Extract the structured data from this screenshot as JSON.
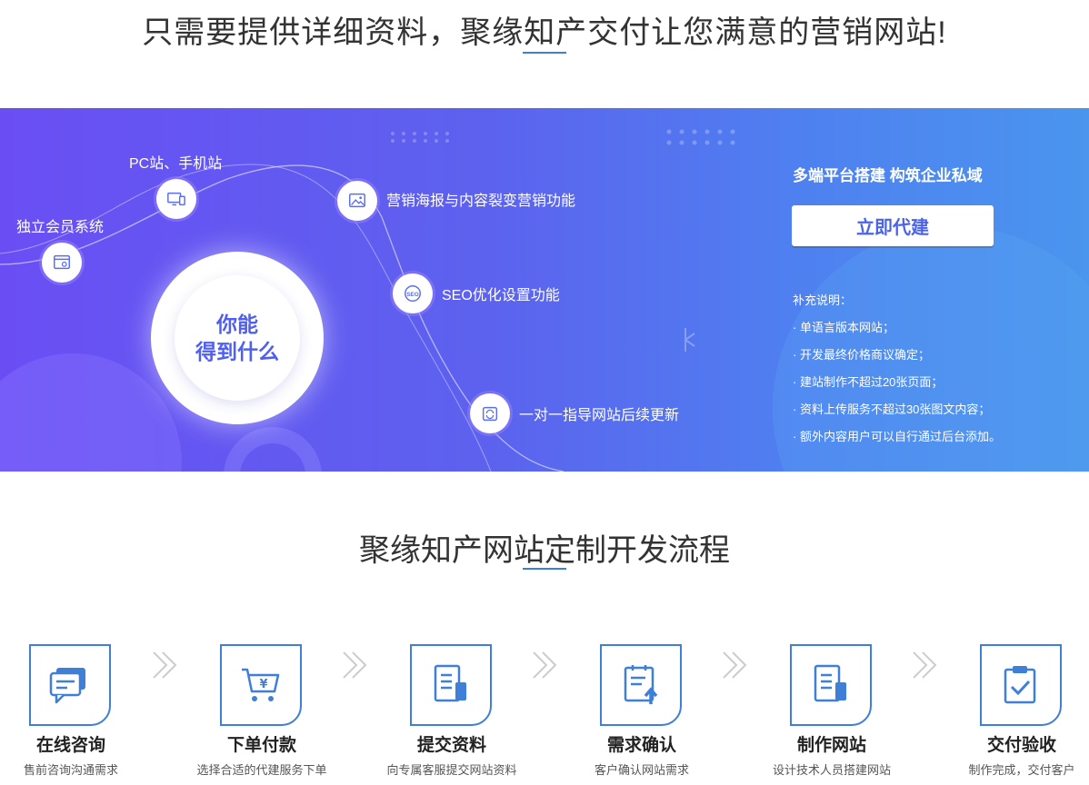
{
  "header": {
    "title": "只需要提供详细资料，聚缘知产交付让您满意的营销网站!"
  },
  "banner": {
    "features": [
      {
        "label": "PC站、手机站",
        "icon": "devices-icon"
      },
      {
        "label": "独立会员系统",
        "icon": "member-system-icon"
      },
      {
        "label": "营销海报与内容裂变营销功能",
        "icon": "poster-image-icon"
      },
      {
        "label": "SEO优化设置功能",
        "icon": "seo-icon"
      },
      {
        "label": "一对一指导网站后续更新",
        "icon": "update-refresh-icon"
      }
    ],
    "center_line1": "你能",
    "center_line2": "得到什么",
    "right_heading": "多端平台搭建 构筑企业私域",
    "cta_label": "立即代建",
    "notes_title": "补充说明：",
    "notes": [
      "· 单语言版本网站；",
      "· 开发最终价格商议确定；",
      "· 建站制作不超过20张页面；",
      "· 资料上传服务不超过30张图文内容；",
      "· 额外内容用户可以自行通过后台添加。"
    ],
    "colors": {
      "gradient_start": "#6a4ef4",
      "gradient_end": "#4a95ee",
      "accent": "#4a63ea"
    }
  },
  "process": {
    "title": "聚缘知产网站定制开发流程",
    "steps": [
      {
        "title": "在线咨询",
        "desc": "售前咨询沟通需求",
        "icon": "chat-bubble-icon"
      },
      {
        "title": "下单付款",
        "desc": "选择合适的代建服务下单",
        "icon": "shopping-cart-icon"
      },
      {
        "title": "提交资料",
        "desc": "向专属客服提交网站资料",
        "icon": "document-icon"
      },
      {
        "title": "需求确认",
        "desc": "客户确认网站需求",
        "icon": "clipboard-upload-icon"
      },
      {
        "title": "制作网站",
        "desc": "设计技术人员搭建网站",
        "icon": "document-build-icon"
      },
      {
        "title": "交付验收",
        "desc": "制作完成，交付客户",
        "icon": "clipboard-check-icon"
      }
    ],
    "accent": "#3f7fd8"
  }
}
